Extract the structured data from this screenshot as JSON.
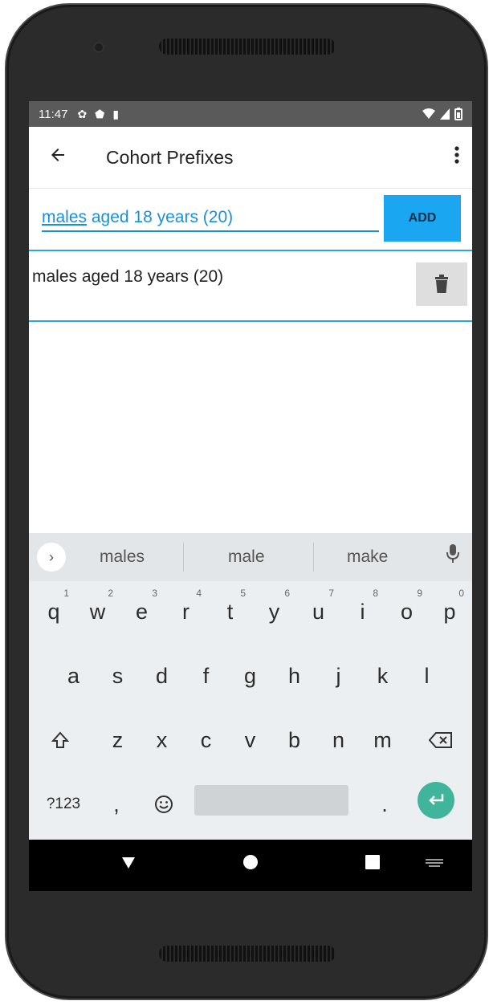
{
  "status_bar": {
    "time": "11:47"
  },
  "app_bar": {
    "title": "Cohort Prefixes"
  },
  "input": {
    "value_underlined": "males",
    "value_rest": " aged 18 years (20)",
    "add_label": "ADD"
  },
  "list": {
    "items": [
      {
        "label": "males aged 18 years (20)"
      }
    ]
  },
  "keyboard": {
    "suggestions": [
      "males",
      "male",
      "make"
    ],
    "row1": [
      {
        "k": "q",
        "h": "1"
      },
      {
        "k": "w",
        "h": "2"
      },
      {
        "k": "e",
        "h": "3"
      },
      {
        "k": "r",
        "h": "4"
      },
      {
        "k": "t",
        "h": "5"
      },
      {
        "k": "y",
        "h": "6"
      },
      {
        "k": "u",
        "h": "7"
      },
      {
        "k": "i",
        "h": "8"
      },
      {
        "k": "o",
        "h": "9"
      },
      {
        "k": "p",
        "h": "0"
      }
    ],
    "row2": [
      "a",
      "s",
      "d",
      "f",
      "g",
      "h",
      "j",
      "k",
      "l"
    ],
    "row3": [
      "z",
      "x",
      "c",
      "v",
      "b",
      "n",
      "m"
    ],
    "row4": {
      "symbols": "?123",
      "comma": ",",
      "period": "."
    }
  },
  "colors": {
    "accent": "#1aa6f0",
    "enter_key": "#41b59b",
    "status_bar": "#5a5a5a"
  }
}
